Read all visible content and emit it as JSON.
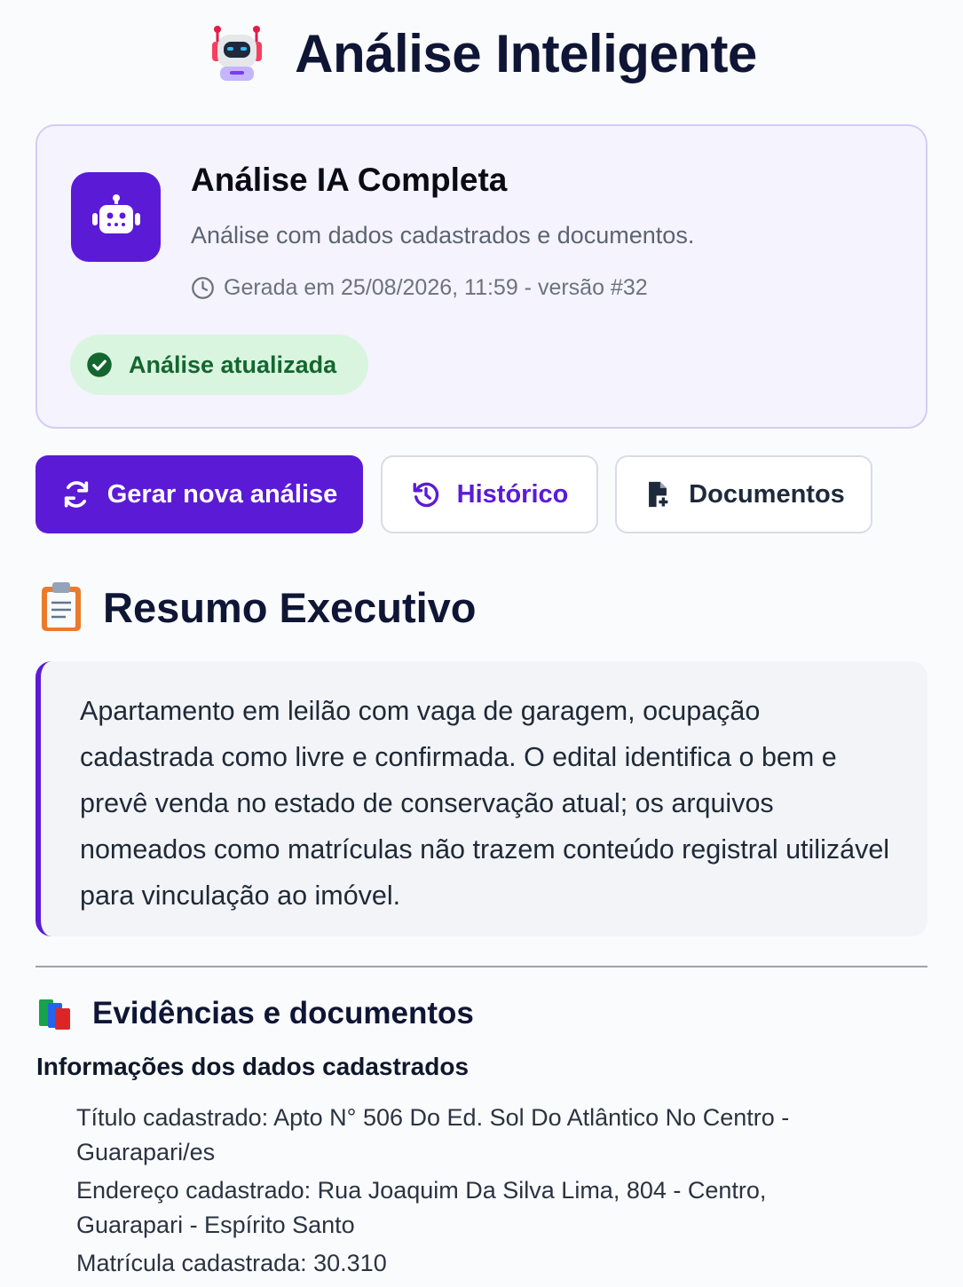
{
  "header": {
    "title": "Análise Inteligente",
    "icon": "robot-emoji-icon"
  },
  "card": {
    "title": "Análise IA Completa",
    "subtitle": "Análise com dados cadastrados e documentos.",
    "meta": "Gerada em 25/08/2026, 11:59 - versão #32",
    "badge": "Análise atualizada",
    "accent": "#5b1bd6",
    "badge_color": "#14662f"
  },
  "actions": {
    "generate": "Gerar nova análise",
    "history": "Histórico",
    "documents": "Documentos"
  },
  "summary": {
    "title": "Resumo Executivo",
    "text": "Apartamento em leilão com vaga de garagem, ocupação cadastrada como livre e confirmada. O edital identifica o bem e prevê venda no estado de conservação atual; os arquivos nomeados como matrículas não trazem conteúdo registral utilizável para vinculação ao imóvel."
  },
  "evidence": {
    "title": "Evidências e documentos",
    "subheading": "Informações dos dados cadastrados",
    "items": [
      "Título cadastrado: Apto N° 506 Do Ed. Sol Do Atlântico No Centro - Guarapari/es",
      "Endereço cadastrado: Rua Joaquim Da Silva Lima, 804 - Centro, Guarapari - Espírito Santo",
      "Matrícula cadastrada: 30.310"
    ]
  }
}
